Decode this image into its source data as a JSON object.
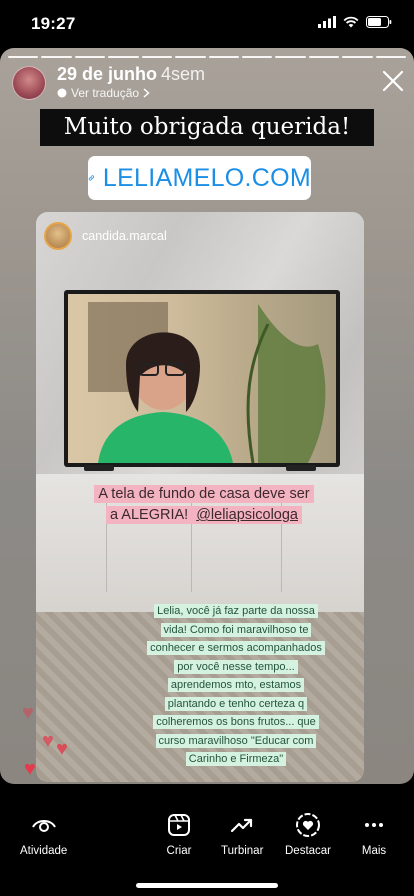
{
  "status_bar": {
    "time": "19:27"
  },
  "story": {
    "date": "29 de junho",
    "ago": "4sem",
    "translate_label": "Ver tradução",
    "title_text": "Muito obrigada querida!",
    "link_text": "LELIAMELO.COM"
  },
  "repost": {
    "username": "candida.marcal",
    "caption_main": "A tela de fundo de casa deve ser a ALEGRIA!",
    "caption_mention": "@leliapsicologa",
    "comment_lines": [
      "Lelia, você já faz parte da nossa",
      "vida! Como foi maravilhoso te",
      "conhecer e sermos acompanhados",
      "por você nesse tempo...",
      "aprendemos mto, estamos",
      "plantando e tenho certeza q",
      "colheremos os bons frutos... que",
      "curso maravilhoso \"Educar com",
      "Carinho e Firmeza\""
    ]
  },
  "bottom_nav": {
    "activity": "Atividade",
    "create": "Criar",
    "boost": "Turbinar",
    "highlight": "Destacar",
    "more": "Mais"
  },
  "colors": {
    "link_blue": "#1b8ee6",
    "pink_caption": "#f4b3c0",
    "green_caption": "#d5f1e0",
    "heart_red": "#e6394b"
  }
}
